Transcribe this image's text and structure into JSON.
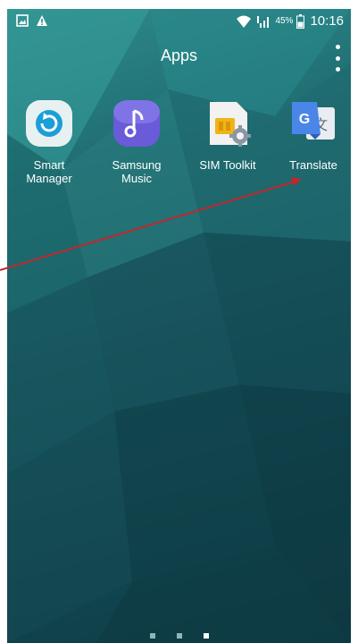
{
  "status_bar": {
    "battery_percent": "45%",
    "time": "10:16",
    "left_icons": [
      "gallery-icon",
      "warning-icon"
    ],
    "right_icons": [
      "wifi-icon",
      "signal-icon",
      "battery-icon"
    ]
  },
  "header": {
    "title": "Apps",
    "menu_icon": "more-vert-icon"
  },
  "apps": [
    {
      "label_line1": "Smart",
      "label_line2": "Manager",
      "icon": "smart-manager-icon"
    },
    {
      "label_line1": "Samsung",
      "label_line2": "Music",
      "icon": "samsung-music-icon"
    },
    {
      "label_line1": "SIM Toolkit",
      "label_line2": "",
      "icon": "sim-toolkit-icon"
    },
    {
      "label_line1": "Translate",
      "label_line2": "",
      "icon": "google-translate-icon"
    }
  ],
  "page_indicator": {
    "pages": 3,
    "current": 3
  },
  "colors": {
    "wallpaper": "#17565f",
    "annotation_arrow": "#c0282d"
  }
}
